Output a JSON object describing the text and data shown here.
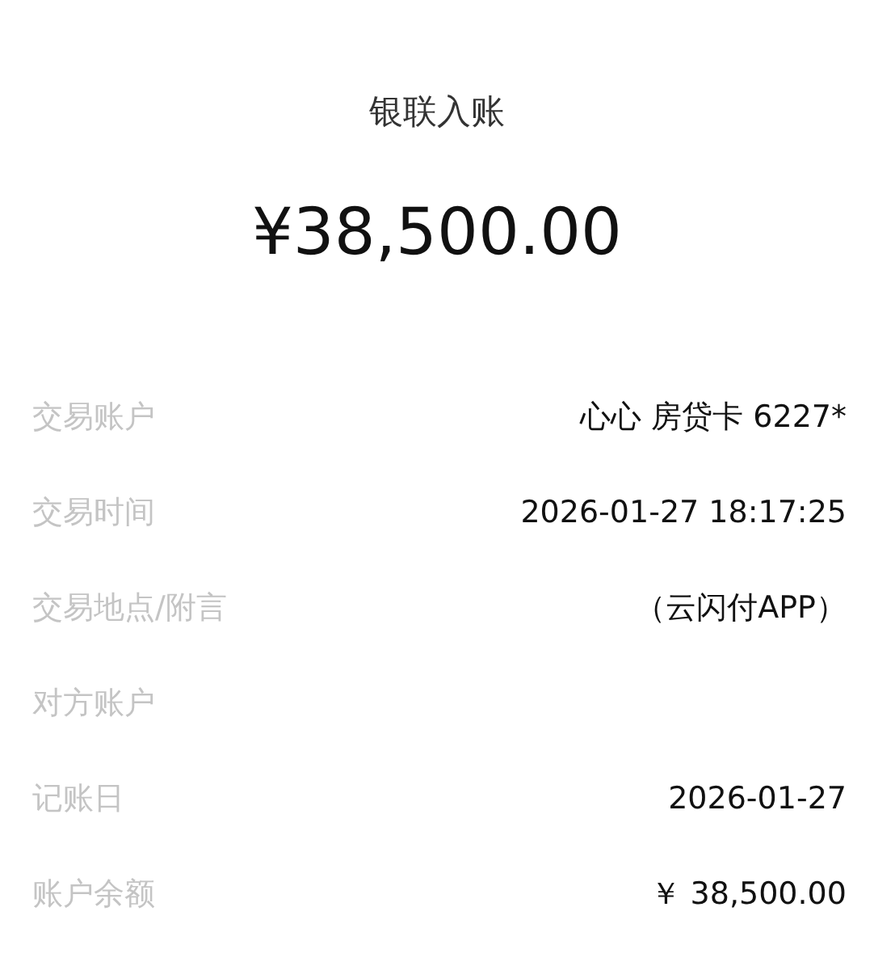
{
  "title": "银联入账",
  "amount": "¥38,500.00",
  "details": [
    {
      "label": "交易账户",
      "value": "心心 房贷卡 6227*"
    },
    {
      "label": "交易时间",
      "value": "2026-01-27 18:17:25"
    },
    {
      "label": "交易地点/附言",
      "value": "（云闪付APP）"
    },
    {
      "label": "对方账户"
    },
    {
      "label": "记账日",
      "value": "2026-01-27"
    },
    {
      "label": "账户余额",
      "value": "￥ 38,500.00"
    }
  ]
}
